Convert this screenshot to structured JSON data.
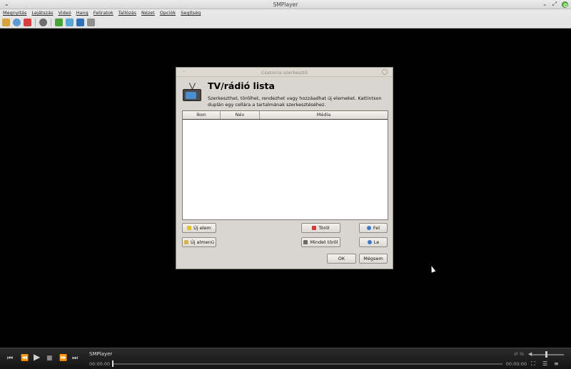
{
  "window": {
    "title": "SMPlayer",
    "menu_glyph": "⌄",
    "min": "⌄",
    "restore": "⤢"
  },
  "menu": [
    "Megnyitás",
    "Lejátszás",
    "Videó",
    "Hang",
    "Feliratok",
    "Tallózás",
    "Nézet",
    "Opciók",
    "Segítség"
  ],
  "toolbar_icons": [
    {
      "name": "open-folder-icon",
      "color": "#d8a23a"
    },
    {
      "name": "open-disc-icon",
      "color": "#5b9bd5"
    },
    {
      "name": "favorites-icon",
      "color": "#d64040"
    },
    {
      "name": "record-icon",
      "color": "#6d6d6d"
    },
    {
      "name": "playlist-icon",
      "color": "#4aa33a"
    },
    {
      "name": "equalizer-icon",
      "color": "#58a6d6"
    },
    {
      "name": "screenshot-icon",
      "color": "#2f6fb5"
    },
    {
      "name": "preferences-icon",
      "color": "#8f8f8f"
    }
  ],
  "dialog": {
    "title": "Csatorna szerkesztő",
    "minimize": "–",
    "heading": "TV/rádió lista",
    "description": "Szerkeszthet, törölhet, rendezhet vagy hozzáadhat új elemeket. Kattintson duplán egy cellára a tartalmának szerkesztéséhez.",
    "columns": [
      "Ikon",
      "Név",
      "Média"
    ],
    "buttons": {
      "new_item": "Új elem",
      "new_submenu": "Új almenü",
      "delete": "Töröl",
      "delete_all": "Mindet töröl",
      "up": "Fel",
      "down": "Le",
      "ok": "OK",
      "cancel": "Mégsem"
    }
  },
  "player": {
    "name": "SMPlayer",
    "time_current": "00:00:00",
    "time_total": "00:00:00"
  }
}
